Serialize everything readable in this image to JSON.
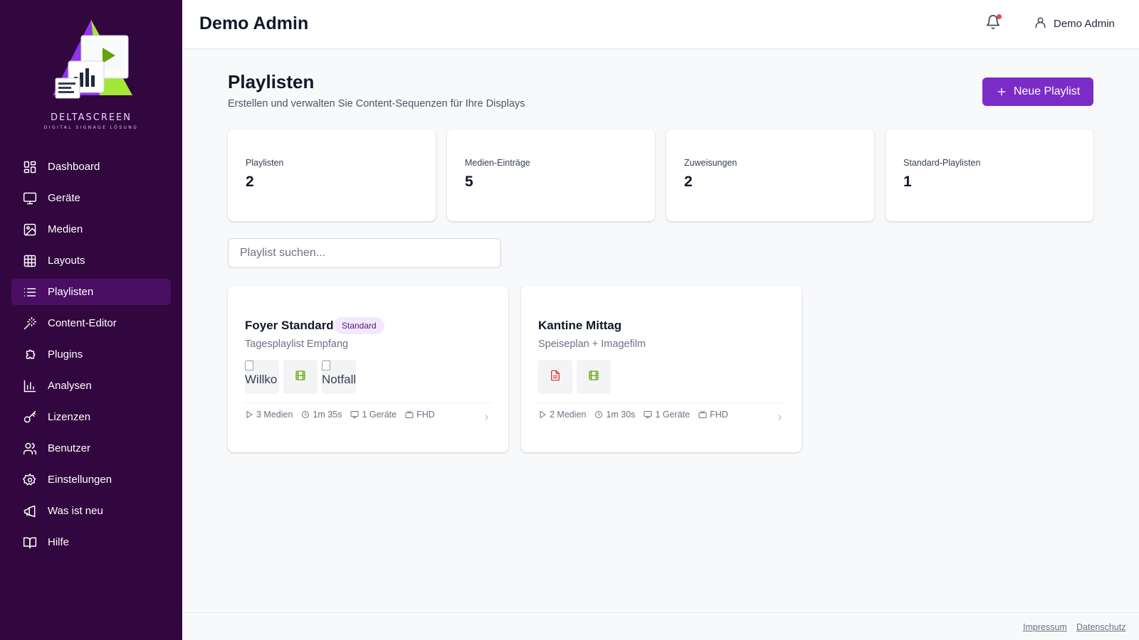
{
  "brand": {
    "name": "DELTASCREEN",
    "tagline": "DIGITAL SIGNAGE LÖSUNG"
  },
  "sidebar": {
    "items": [
      {
        "label": "Dashboard",
        "icon": "dashboard-icon"
      },
      {
        "label": "Geräte",
        "icon": "monitor-icon"
      },
      {
        "label": "Medien",
        "icon": "image-icon"
      },
      {
        "label": "Layouts",
        "icon": "grid-icon"
      },
      {
        "label": "Playlisten",
        "icon": "list-icon",
        "active": true
      },
      {
        "label": "Content-Editor",
        "icon": "magic-wand-icon"
      },
      {
        "label": "Plugins",
        "icon": "puzzle-icon"
      },
      {
        "label": "Analysen",
        "icon": "bar-chart-icon"
      },
      {
        "label": "Lizenzen",
        "icon": "key-icon"
      },
      {
        "label": "Benutzer",
        "icon": "users-icon"
      },
      {
        "label": "Einstellungen",
        "icon": "gear-icon"
      },
      {
        "label": "Was ist neu",
        "icon": "megaphone-icon"
      },
      {
        "label": "Hilfe",
        "icon": "book-icon"
      }
    ]
  },
  "header": {
    "title": "Demo Admin",
    "user_name": "Demo Admin"
  },
  "page": {
    "title": "Playlisten",
    "subtitle": "Erstellen und verwalten Sie Content-Sequenzen für Ihre Displays",
    "new_button": "Neue Playlist"
  },
  "stats": [
    {
      "label": "Playlisten",
      "value": "2"
    },
    {
      "label": "Medien-Einträge",
      "value": "5"
    },
    {
      "label": "Zuweisungen",
      "value": "2"
    },
    {
      "label": "Standard-Playlisten",
      "value": "1"
    }
  ],
  "search": {
    "placeholder": "Playlist suchen..."
  },
  "playlists": [
    {
      "name": "Foyer Standard",
      "badge": "Standard",
      "description": "Tagesplaylist Empfang",
      "thumbs": [
        {
          "type": "broken-image",
          "alt": "Willko"
        },
        {
          "type": "video",
          "icon": "film-icon"
        },
        {
          "type": "broken-image",
          "alt": "Notfall"
        }
      ],
      "media_count": "3 Medien",
      "duration": "1m 35s",
      "devices": "1 Geräte",
      "resolution": "FHD"
    },
    {
      "name": "Kantine Mittag",
      "badge": "",
      "description": "Speiseplan + Imagefilm",
      "thumbs": [
        {
          "type": "document",
          "icon": "file-text-icon"
        },
        {
          "type": "video",
          "icon": "film-icon"
        }
      ],
      "media_count": "2 Medien",
      "duration": "1m 30s",
      "devices": "1 Geräte",
      "resolution": "FHD"
    }
  ],
  "footer": {
    "impressum": "Impressum",
    "datenschutz": "Datenschutz"
  },
  "colors": {
    "sidebar_bg": "#32063e",
    "sidebar_active": "#4a0e63",
    "accent": "#7b2cc7",
    "badge_bg": "#f3e8ff",
    "video_icon": "#65a30d",
    "document_icon": "#dc2626",
    "notification_dot": "#ef4444"
  }
}
